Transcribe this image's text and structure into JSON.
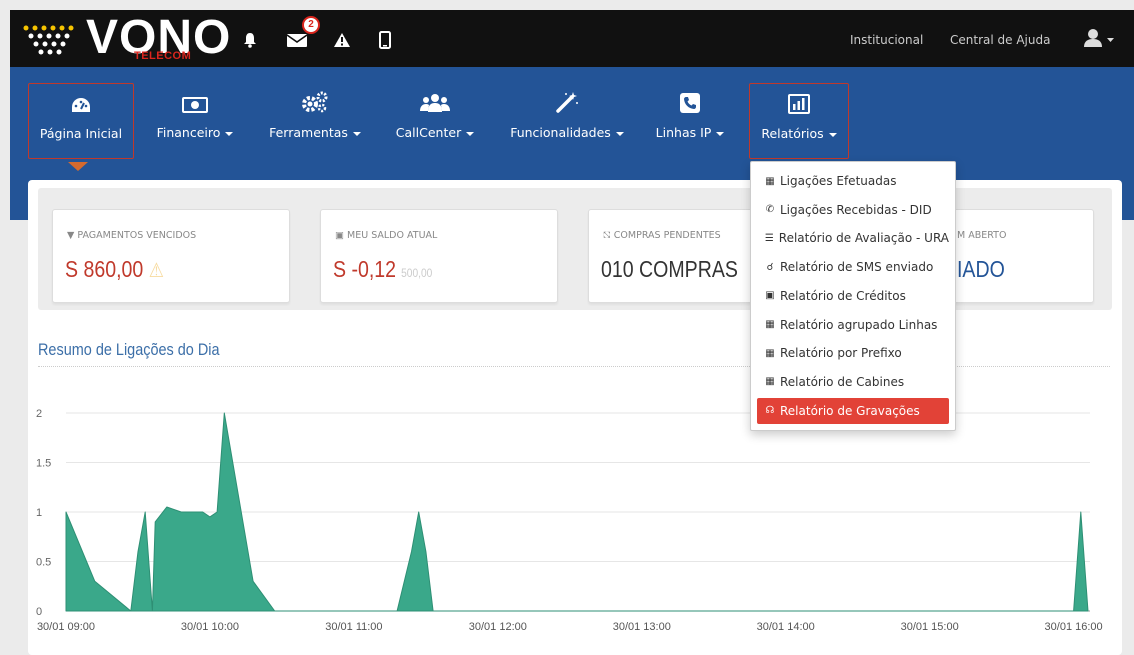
{
  "colors": {
    "topbar": "#111111",
    "nav": "#235497",
    "accent_red": "#c0392b",
    "highlight": "#e24237",
    "chart_fill": "#3aa88a"
  },
  "topbar": {
    "logo_text": "VONO",
    "logo_sub": "TELECOM",
    "messages_badge": "2",
    "links": [
      "Institucional",
      "Central de Ajuda"
    ],
    "icons": [
      "bell-icon",
      "envelope-icon",
      "warning-icon",
      "mobile-icon",
      "user-icon"
    ]
  },
  "nav": {
    "items": [
      {
        "label": "Página Inicial",
        "icon": "dashboard-icon",
        "active": true
      },
      {
        "label": "Financeiro",
        "icon": "money-icon"
      },
      {
        "label": "Ferramentas",
        "icon": "cogs-icon"
      },
      {
        "label": "CallCenter",
        "icon": "users-icon"
      },
      {
        "label": "Funcionalidades",
        "icon": "magic-wand-icon"
      },
      {
        "label": "Linhas IP",
        "icon": "phone-icon"
      },
      {
        "label": "Relatórios",
        "icon": "bar-chart-icon",
        "open": true
      }
    ]
  },
  "stats": [
    {
      "title": "PAGAMENTOS VENCIDOS",
      "value": "S 860,00",
      "icon": "thumbs-down-icon"
    },
    {
      "title": "MEU SALDO ATUAL",
      "value": "S -0,12",
      "extra": "500,00",
      "icon": "money-icon"
    },
    {
      "title": "COMPRAS PENDENTES",
      "value": "010 COMPRAS",
      "icon": "cart-icon"
    },
    {
      "title": "M ABERTO",
      "value": "IADO"
    }
  ],
  "section": {
    "title": "Resumo de Ligações do Dia"
  },
  "dropdown": {
    "items": [
      {
        "label": "Ligações Efetuadas",
        "icon": "bar-chart-icon"
      },
      {
        "label": "Ligações Recebidas - DID",
        "icon": "phone-icon"
      },
      {
        "label": "Relatório de Avaliação - URA",
        "icon": "list-icon"
      },
      {
        "label": "Relatório de SMS enviado",
        "icon": "comment-icon"
      },
      {
        "label": "Relatório de Créditos",
        "icon": "money-icon"
      },
      {
        "label": "Relatório agrupado Linhas",
        "icon": "bar-chart-icon"
      },
      {
        "label": "Relatório por Prefixo",
        "icon": "bar-chart-icon"
      },
      {
        "label": "Relatório de Cabines",
        "icon": "table-icon"
      },
      {
        "label": "Relatório de Gravações",
        "icon": "headphones-icon",
        "highlighted": true
      }
    ]
  },
  "chart_data": {
    "type": "area",
    "title": "",
    "xlabel": "",
    "ylabel": "",
    "ylim": [
      0,
      2
    ],
    "yticks": [
      "0",
      "0.5",
      "1",
      "1.5",
      "2"
    ],
    "xticks": [
      "30/01 09:00",
      "30/01 10:00",
      "30/01 11:00",
      "30/01 12:00",
      "30/01 13:00",
      "30/01 14:00",
      "30/01 15:00",
      "30/01 16:00"
    ],
    "x_hours": [
      9.0,
      9.2,
      9.45,
      9.5,
      9.55,
      9.6,
      9.62,
      9.7,
      9.8,
      9.95,
      10.0,
      10.05,
      10.1,
      10.3,
      10.45,
      10.5,
      10.55,
      10.6,
      11.3,
      11.4,
      11.45,
      11.5,
      11.55,
      11.65,
      16.0,
      16.05,
      16.1
    ],
    "values": [
      1,
      0.3,
      0,
      0.6,
      1,
      0,
      0.9,
      1.05,
      1.0,
      1.0,
      0.95,
      1.0,
      2,
      0.3,
      0,
      0,
      0,
      0,
      0,
      0.6,
      1,
      0.6,
      0,
      0,
      0,
      1,
      0
    ]
  }
}
